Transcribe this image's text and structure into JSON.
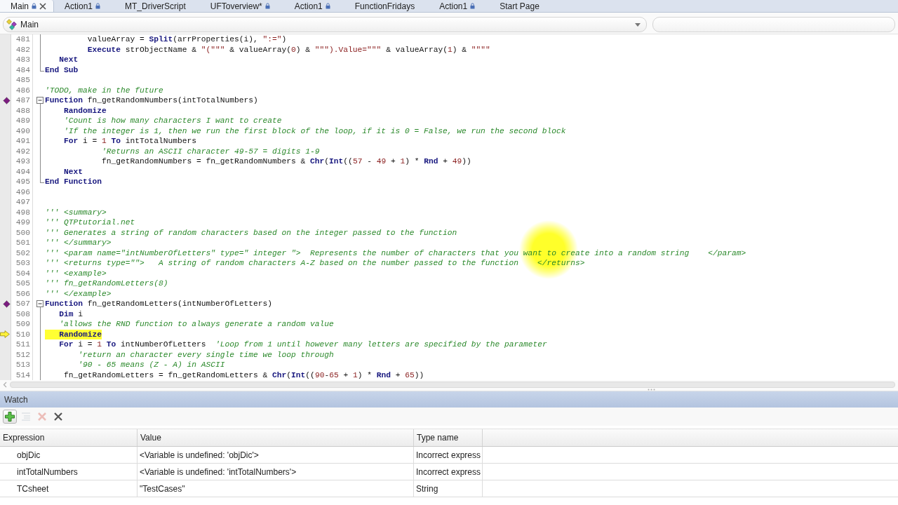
{
  "tabs": [
    {
      "label": "Main",
      "selected": true,
      "locked": true
    },
    {
      "label": "Action1",
      "selected": false,
      "locked": true
    },
    {
      "label": "MT_DriverScript",
      "selected": false,
      "locked": false
    },
    {
      "label": "UFToverview*",
      "selected": false,
      "locked": true
    },
    {
      "label": "Action1",
      "selected": false,
      "locked": true
    },
    {
      "label": "FunctionFridays",
      "selected": false,
      "locked": false
    },
    {
      "label": "Action1",
      "selected": false,
      "locked": true
    },
    {
      "label": "Start Page",
      "selected": false,
      "locked": false
    }
  ],
  "scope_dropdown": {
    "value": "Main"
  },
  "editor": {
    "lines": [
      {
        "number": "481",
        "highlighted": false,
        "fold": {
          "kind": "body"
        },
        "segments": [
          {
            "kind": "identifier",
            "text": "         valueArray = "
          },
          {
            "kind": "keyword",
            "text": "Split"
          },
          {
            "kind": "identifier",
            "text": "(arrProperties(i), "
          },
          {
            "kind": "string",
            "text": "\":=\""
          },
          {
            "kind": "identifier",
            "text": ")"
          }
        ]
      },
      {
        "number": "482",
        "highlighted": false,
        "fold": {
          "kind": "body"
        },
        "segments": [
          {
            "kind": "keyword",
            "text": "         Execute"
          },
          {
            "kind": "identifier",
            "text": " strObjectName & "
          },
          {
            "kind": "string",
            "text": "\"(\"\"\""
          },
          {
            "kind": "identifier",
            "text": " & valueArray("
          },
          {
            "kind": "number",
            "text": "0"
          },
          {
            "kind": "identifier",
            "text": ") & "
          },
          {
            "kind": "string",
            "text": "\"\"\").Value=\"\"\""
          },
          {
            "kind": "identifier",
            "text": " & valueArray("
          },
          {
            "kind": "number",
            "text": "1"
          },
          {
            "kind": "identifier",
            "text": ") & "
          },
          {
            "kind": "string",
            "text": "\"\"\"\""
          }
        ]
      },
      {
        "number": "483",
        "highlighted": false,
        "fold": {
          "kind": "body"
        },
        "segments": [
          {
            "kind": "keyword",
            "text": "   Next"
          }
        ]
      },
      {
        "number": "484",
        "highlighted": false,
        "fold": {
          "kind": "end"
        },
        "segments": [
          {
            "kind": "keyword",
            "text": "End Sub"
          }
        ]
      },
      {
        "number": "485"
      },
      {
        "number": "486",
        "highlighted": false,
        "segments": [
          {
            "kind": "comment",
            "text": "'TODO, make in the future"
          }
        ]
      },
      {
        "number": "487",
        "highlighted": false,
        "marker": {
          "kind": "bookmark"
        },
        "fold": {
          "kind": "start",
          "expanded": true
        },
        "segments": [
          {
            "kind": "keyword",
            "text": "Function"
          },
          {
            "kind": "identifier",
            "text": " fn_getRandomNumbers(intTotalNumbers)"
          }
        ]
      },
      {
        "number": "488",
        "highlighted": false,
        "fold": {
          "kind": "body"
        },
        "segments": [
          {
            "kind": "keyword",
            "text": "    Randomize"
          }
        ]
      },
      {
        "number": "489",
        "highlighted": false,
        "fold": {
          "kind": "body"
        },
        "segments": [
          {
            "kind": "comment",
            "text": "    'Count is how many characters I want to create"
          }
        ]
      },
      {
        "number": "490",
        "highlighted": false,
        "fold": {
          "kind": "body"
        },
        "segments": [
          {
            "kind": "comment",
            "text": "    'If the integer is 1, then we run the first block of the loop, if it is 0 = False, we run the second block"
          }
        ]
      },
      {
        "number": "491",
        "highlighted": false,
        "fold": {
          "kind": "body"
        },
        "segments": [
          {
            "kind": "keyword",
            "text": "    For"
          },
          {
            "kind": "identifier",
            "text": " i = "
          },
          {
            "kind": "number",
            "text": "1"
          },
          {
            "kind": "keyword",
            "text": " To"
          },
          {
            "kind": "identifier",
            "text": " intTotalNumbers"
          }
        ]
      },
      {
        "number": "492",
        "highlighted": false,
        "fold": {
          "kind": "body"
        },
        "segments": [
          {
            "kind": "comment",
            "text": "            'Returns an ASCII character 49-57 = digits 1-9"
          }
        ]
      },
      {
        "number": "493",
        "highlighted": false,
        "fold": {
          "kind": "body"
        },
        "segments": [
          {
            "kind": "identifier",
            "text": "            fn_getRandomNumbers = fn_getRandomNumbers & "
          },
          {
            "kind": "keyword",
            "text": "Chr"
          },
          {
            "kind": "identifier",
            "text": "("
          },
          {
            "kind": "keyword",
            "text": "Int"
          },
          {
            "kind": "identifier",
            "text": "(("
          },
          {
            "kind": "number",
            "text": "57"
          },
          {
            "kind": "identifier",
            "text": " - "
          },
          {
            "kind": "number",
            "text": "49"
          },
          {
            "kind": "identifier",
            "text": " + "
          },
          {
            "kind": "number",
            "text": "1"
          },
          {
            "kind": "identifier",
            "text": ") * "
          },
          {
            "kind": "keyword",
            "text": "Rnd"
          },
          {
            "kind": "identifier",
            "text": " + "
          },
          {
            "kind": "number",
            "text": "49"
          },
          {
            "kind": "identifier",
            "text": "))"
          }
        ]
      },
      {
        "number": "494",
        "highlighted": false,
        "fold": {
          "kind": "body"
        },
        "segments": [
          {
            "kind": "keyword",
            "text": "    Next"
          }
        ]
      },
      {
        "number": "495",
        "highlighted": false,
        "fold": {
          "kind": "end"
        },
        "segments": [
          {
            "kind": "keyword",
            "text": "End Function"
          }
        ]
      },
      {
        "number": "496"
      },
      {
        "number": "497"
      },
      {
        "number": "498",
        "highlighted": false,
        "segments": [
          {
            "kind": "comment",
            "text": "''' <summary>"
          }
        ]
      },
      {
        "number": "499",
        "highlighted": false,
        "segments": [
          {
            "kind": "comment",
            "text": "''' QTPtutorial.net"
          }
        ]
      },
      {
        "number": "500",
        "highlighted": false,
        "segments": [
          {
            "kind": "comment",
            "text": "''' Generates a string of random characters based on the integer passed to the function"
          }
        ]
      },
      {
        "number": "501",
        "highlighted": false,
        "segments": [
          {
            "kind": "comment",
            "text": "''' </summary>"
          }
        ]
      },
      {
        "number": "502",
        "highlighted": false,
        "segments": [
          {
            "kind": "comment",
            "text": "''' <param name=\"intNumberOfLetters\" type=\" integer \">  Represents the number of characters that you want to create into a random string    </param>"
          }
        ]
      },
      {
        "number": "503",
        "highlighted": false,
        "segments": [
          {
            "kind": "comment",
            "text": "''' <returns type=\"\">   A string of random characters A-Z based on the number passed to the function    </returns>"
          }
        ]
      },
      {
        "number": "504",
        "highlighted": false,
        "segments": [
          {
            "kind": "comment",
            "text": "''' <example>"
          }
        ]
      },
      {
        "number": "505",
        "highlighted": false,
        "segments": [
          {
            "kind": "comment",
            "text": "''' fn_getRandomLetters(8)"
          }
        ]
      },
      {
        "number": "506",
        "highlighted": false,
        "segments": [
          {
            "kind": "comment",
            "text": "''' </example>"
          }
        ]
      },
      {
        "number": "507",
        "highlighted": false,
        "marker": {
          "kind": "bookmark"
        },
        "fold": {
          "kind": "start",
          "expanded": true
        },
        "segments": [
          {
            "kind": "keyword",
            "text": "Function"
          },
          {
            "kind": "identifier",
            "text": " fn_getRandomLetters(intNumberOfLetters)"
          }
        ]
      },
      {
        "number": "508",
        "highlighted": false,
        "fold": {
          "kind": "body"
        },
        "segments": [
          {
            "kind": "keyword",
            "text": "   Dim"
          },
          {
            "kind": "identifier",
            "text": " i"
          }
        ]
      },
      {
        "number": "509",
        "highlighted": false,
        "fold": {
          "kind": "body"
        },
        "segments": [
          {
            "kind": "comment",
            "text": "   'allows the RND function to always generate a random value"
          }
        ]
      },
      {
        "number": "510",
        "highlighted": true,
        "marker": {
          "kind": "current"
        },
        "fold": {
          "kind": "body"
        },
        "segments": [
          {
            "kind": "keyword",
            "text": "   Randomize"
          }
        ]
      },
      {
        "number": "511",
        "highlighted": false,
        "fold": {
          "kind": "body"
        },
        "segments": [
          {
            "kind": "keyword",
            "text": "   For"
          },
          {
            "kind": "identifier",
            "text": " i = "
          },
          {
            "kind": "number",
            "text": "1"
          },
          {
            "kind": "keyword",
            "text": " To"
          },
          {
            "kind": "identifier",
            "text": " intNumberOfLetters  "
          },
          {
            "kind": "comment",
            "text": "'Loop from 1 until however many letters are specified by the parameter"
          }
        ]
      },
      {
        "number": "512",
        "highlighted": false,
        "fold": {
          "kind": "body"
        },
        "segments": [
          {
            "kind": "comment",
            "text": "       'return an character every single time we loop through"
          }
        ]
      },
      {
        "number": "513",
        "highlighted": false,
        "fold": {
          "kind": "body"
        },
        "segments": [
          {
            "kind": "comment",
            "text": "       '90 - 65 means (Z - A) in ASCII"
          }
        ]
      },
      {
        "number": "514",
        "highlighted": false,
        "fold": {
          "kind": "body"
        },
        "segments": [
          {
            "kind": "identifier",
            "text": "    fn_getRandomLetters = fn_getRandomLetters & "
          },
          {
            "kind": "keyword",
            "text": "Chr"
          },
          {
            "kind": "identifier",
            "text": "("
          },
          {
            "kind": "keyword",
            "text": "Int"
          },
          {
            "kind": "identifier",
            "text": "(("
          },
          {
            "kind": "number",
            "text": "90"
          },
          {
            "kind": "identifier",
            "text": "-"
          },
          {
            "kind": "number",
            "text": "65"
          },
          {
            "kind": "identifier",
            "text": " + "
          },
          {
            "kind": "number",
            "text": "1"
          },
          {
            "kind": "identifier",
            "text": ") * "
          },
          {
            "kind": "keyword",
            "text": "Rnd"
          },
          {
            "kind": "identifier",
            "text": " + "
          },
          {
            "kind": "number",
            "text": "65"
          },
          {
            "kind": "identifier",
            "text": "))"
          }
        ]
      }
    ]
  },
  "watch": {
    "title": "Watch",
    "tools": [
      {
        "kind": "add",
        "disabled": false
      },
      {
        "kind": "list",
        "disabled": true
      },
      {
        "kind": "delete",
        "disabled": true
      },
      {
        "kind": "clear",
        "disabled": false
      }
    ],
    "columns": [
      "Expression",
      "Value",
      "Type name"
    ],
    "rows": [
      {
        "expression": "objDic",
        "value": "<Variable is undefined: 'objDic'>",
        "type_name": "Incorrect express"
      },
      {
        "expression": "intTotalNumbers",
        "value": "<Variable is undefined: 'intTotalNumbers'>",
        "type_name": "Incorrect express"
      },
      {
        "expression": "TCsheet",
        "value": "\"TestCases\"",
        "type_name": "String"
      }
    ]
  }
}
